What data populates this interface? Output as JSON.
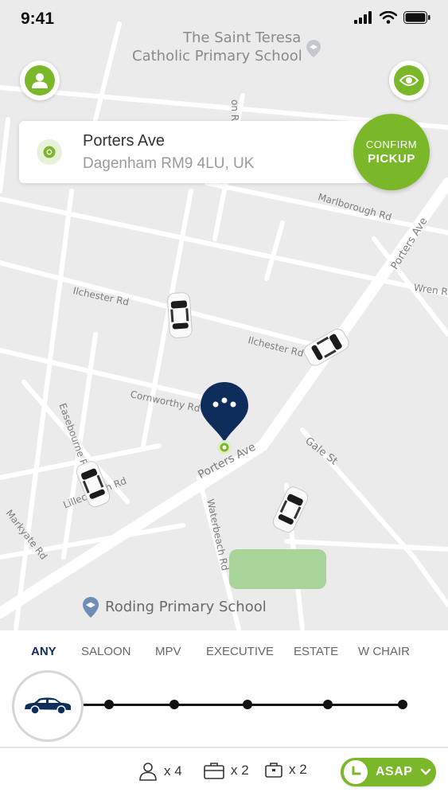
{
  "status_bar": {
    "time": "9:41"
  },
  "map": {
    "poi": {
      "school_top_line1": "The Saint Teresa",
      "school_top_line2": "Catholic Primary School",
      "school_bottom": "Roding Primary School"
    },
    "streets": {
      "ilchester_1": "Ilchester Rd",
      "ilchester_2": "Ilchester Rd",
      "marlborough": "Marlborough Rd",
      "porters_ave_right": "Porters Ave",
      "wren": "Wren Rd",
      "cornworthy": "Cornworthy Rd",
      "porters_ave_center": "Porters Ave",
      "gale": "Gale St",
      "easebourne": "Easebourne Rd",
      "lillechurch": "Lillechurch Rd",
      "markyate": "Markyate Rd",
      "waterbeach": "Waterbeach Rd",
      "upper_rd": "on Rd"
    }
  },
  "pickup": {
    "title": "Porters Ave",
    "subtitle": "Dagenham RM9 4LU, UK",
    "confirm_line1": "CONFIRM",
    "confirm_line2": "PICKUP"
  },
  "vehicle_types": {
    "tabs": [
      "ANY",
      "SALOON",
      "MPV",
      "EXECUTIVE",
      "ESTATE",
      "W CHAIR"
    ],
    "selected": "ANY"
  },
  "capacity": {
    "passengers": "x 4",
    "large_bags": "x 2",
    "small_bags": "x 2"
  },
  "time_select": {
    "label": "ASAP"
  },
  "icons": {
    "profile": "profile-icon",
    "eye": "eye-icon",
    "location": "location-dot-icon",
    "pin": "chat-pin-icon",
    "car": "car-icon",
    "person": "person-icon",
    "suitcase": "suitcase-icon",
    "bag": "briefcase-icon",
    "clock": "clock-icon",
    "chevron": "chevron-down-icon"
  },
  "colors": {
    "accent_green": "#7ab829",
    "navy": "#0e2d5a",
    "map_bg": "#ebebeb",
    "park": "#a8d49a"
  }
}
